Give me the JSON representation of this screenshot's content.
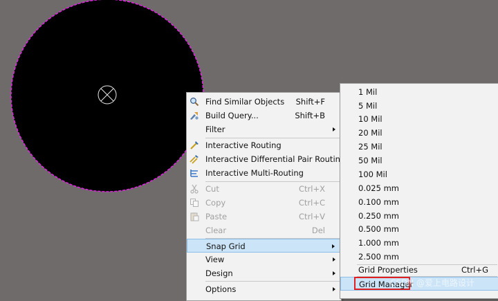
{
  "colors": {
    "canvas_background": "#6f6b6a",
    "pad_fill": "#000000",
    "selection_outline": "#e020e0",
    "highlight": "#cce4f7",
    "annotation_box": "#e02020"
  },
  "context_menu": {
    "items": [
      {
        "label": "Find Similar Objects",
        "shortcut": "Shift+F",
        "icon": "find-similar-icon",
        "disabled": false
      },
      {
        "label": "Build Query...",
        "shortcut": "Shift+B",
        "icon": "build-query-icon",
        "disabled": false
      },
      {
        "label": "Filter",
        "submenu": true,
        "disabled": false
      },
      {
        "label": "Interactive Routing",
        "icon": "interactive-routing-icon",
        "disabled": false
      },
      {
        "label": "Interactive Differential Pair Routing",
        "icon": "diff-pair-routing-icon",
        "disabled": false
      },
      {
        "label": "Interactive Multi-Routing",
        "icon": "multi-routing-icon",
        "disabled": false
      },
      {
        "label": "Cut",
        "shortcut": "Ctrl+X",
        "icon": "cut-icon",
        "disabled": true
      },
      {
        "label": "Copy",
        "shortcut": "Ctrl+C",
        "icon": "copy-icon",
        "disabled": true
      },
      {
        "label": "Paste",
        "shortcut": "Ctrl+V",
        "icon": "paste-icon",
        "disabled": true
      },
      {
        "label": "Clear",
        "shortcut": "Del",
        "disabled": true
      },
      {
        "label": "Snap Grid",
        "submenu": true,
        "highlighted": true
      },
      {
        "label": "View",
        "submenu": true
      },
      {
        "label": "Design",
        "submenu": true
      },
      {
        "label": "Options",
        "submenu": true
      }
    ]
  },
  "snap_grid_menu": {
    "items": [
      {
        "label": "1 Mil"
      },
      {
        "label": "5 Mil"
      },
      {
        "label": "10 Mil"
      },
      {
        "label": "20 Mil"
      },
      {
        "label": "25 Mil"
      },
      {
        "label": "50 Mil"
      },
      {
        "label": "100 Mil"
      },
      {
        "label": "0.025 mm"
      },
      {
        "label": "0.100 mm"
      },
      {
        "label": "0.250 mm"
      },
      {
        "label": "0.500 mm"
      },
      {
        "label": "1.000 mm"
      },
      {
        "label": "2.500 mm"
      },
      {
        "label": "Grid Properties",
        "shortcut": "Ctrl+G"
      },
      {
        "label": "Grid Manager",
        "highlighted": true
      }
    ]
  },
  "watermark": "CSDN @爱上电路设计"
}
